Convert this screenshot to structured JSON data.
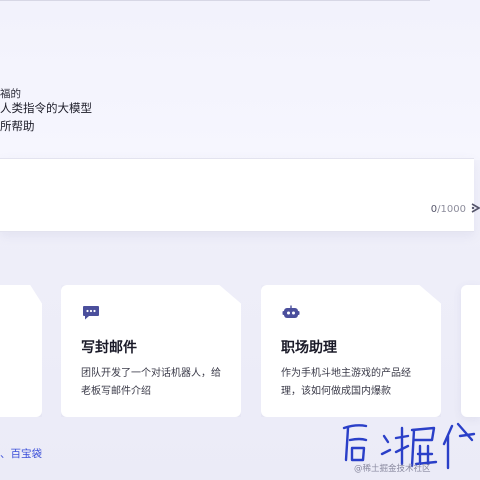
{
  "hero": {
    "line1": "人类指令的大模型",
    "line2": "所帮助"
  },
  "input": {
    "count_current": "0",
    "count_total": "/1000"
  },
  "cards": {
    "left_partial_text": "福的",
    "email": {
      "title": "写封邮件",
      "line1": "团队开发了一个对话机器人，给",
      "line2": "老板写邮件介绍",
      "icon": "chat-bubble-icon"
    },
    "work": {
      "title": "职场助理",
      "line1": "作为手机斗地主游戏的产品经",
      "line2": "理，该如何做成国内爆款",
      "icon": "robot-icon"
    }
  },
  "footer": {
    "link_text": "、百宝袋"
  },
  "watermark": {
    "signature": "后端掘金",
    "source": "@稀土掘金技术社区"
  },
  "colors": {
    "accent": "#3b4fd8",
    "icon_purple": "#4b4f9c",
    "card_bg": "#ffffff"
  }
}
